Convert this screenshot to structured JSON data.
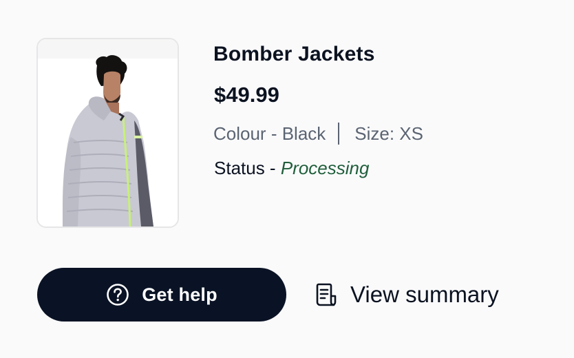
{
  "product": {
    "name": "Bomber Jackets",
    "price": "$49.99",
    "colour": "Colour - Black",
    "size": "Size: XS",
    "status_label": "Status - ",
    "status_value": "Processing",
    "image_icon": "product-image-jacket"
  },
  "actions": {
    "help_label": "Get help",
    "help_icon": "question-circle-icon",
    "summary_label": "View summary",
    "summary_icon": "receipt-document-icon"
  },
  "colors": {
    "background": "#fafafb",
    "primary_button": "#0a1325",
    "status_green": "#1f5e3b",
    "muted_text": "#5b6472"
  }
}
